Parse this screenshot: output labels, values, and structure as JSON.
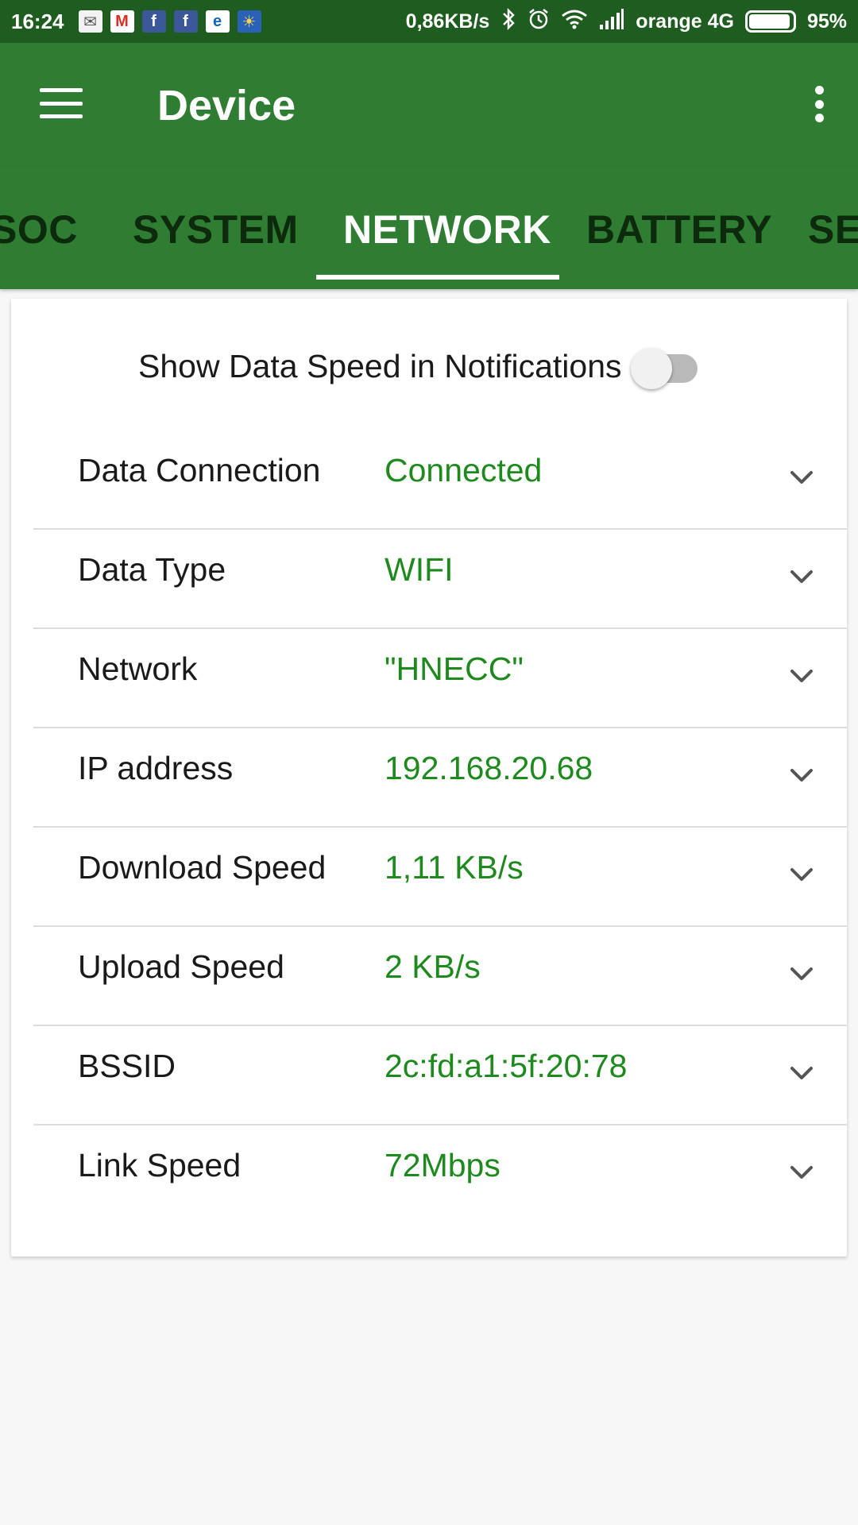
{
  "status_bar": {
    "time": "16:24",
    "notification_icons": [
      {
        "icon": "mail-icon",
        "glyph": "✉",
        "bg": "#f2f2f2",
        "color": "#555555"
      },
      {
        "icon": "gmail-icon",
        "glyph": "M",
        "bg": "#ffffff",
        "color": "#d93025"
      },
      {
        "icon": "facebook-icon",
        "glyph": "f",
        "bg": "#3b5998",
        "color": "#ffffff"
      },
      {
        "icon": "facebook-icon",
        "glyph": "f",
        "bg": "#3b5998",
        "color": "#ffffff"
      },
      {
        "icon": "emag-icon",
        "glyph": "e",
        "bg": "#ffffff",
        "color": "#1565c0"
      },
      {
        "icon": "weather-icon",
        "glyph": "☀",
        "bg": "#2a62b8",
        "color": "#ffd54f"
      }
    ],
    "data_speed": "0,86KB/s",
    "carrier": "orange 4G",
    "battery_percent": "95%",
    "battery_level": 0.95
  },
  "app_bar": {
    "title": "Device"
  },
  "tabs": [
    {
      "label": "SOC",
      "active": false
    },
    {
      "label": "SYSTEM",
      "active": false
    },
    {
      "label": "NETWORK",
      "active": true
    },
    {
      "label": "BATTERY",
      "active": false
    },
    {
      "label": "SE",
      "active": false
    }
  ],
  "notification_toggle": {
    "label": "Show Data Speed in Notifications",
    "enabled": false
  },
  "network_info": [
    {
      "label": "Data Connection",
      "value": "Connected"
    },
    {
      "label": "Data Type",
      "value": "WIFI"
    },
    {
      "label": "Network",
      "value": "\"HNECC\""
    },
    {
      "label": "IP address",
      "value": "192.168.20.68"
    },
    {
      "label": "Download Speed",
      "value": "1,11 KB/s"
    },
    {
      "label": "Upload Speed",
      "value": "2 KB/s"
    },
    {
      "label": "BSSID",
      "value": "2c:fd:a1:5f:20:78"
    },
    {
      "label": "Link Speed",
      "value": "72Mbps"
    }
  ],
  "colors": {
    "status_bar": "#1f5c1f",
    "primary": "#2e7d32",
    "value_text": "#1e8a1e"
  }
}
